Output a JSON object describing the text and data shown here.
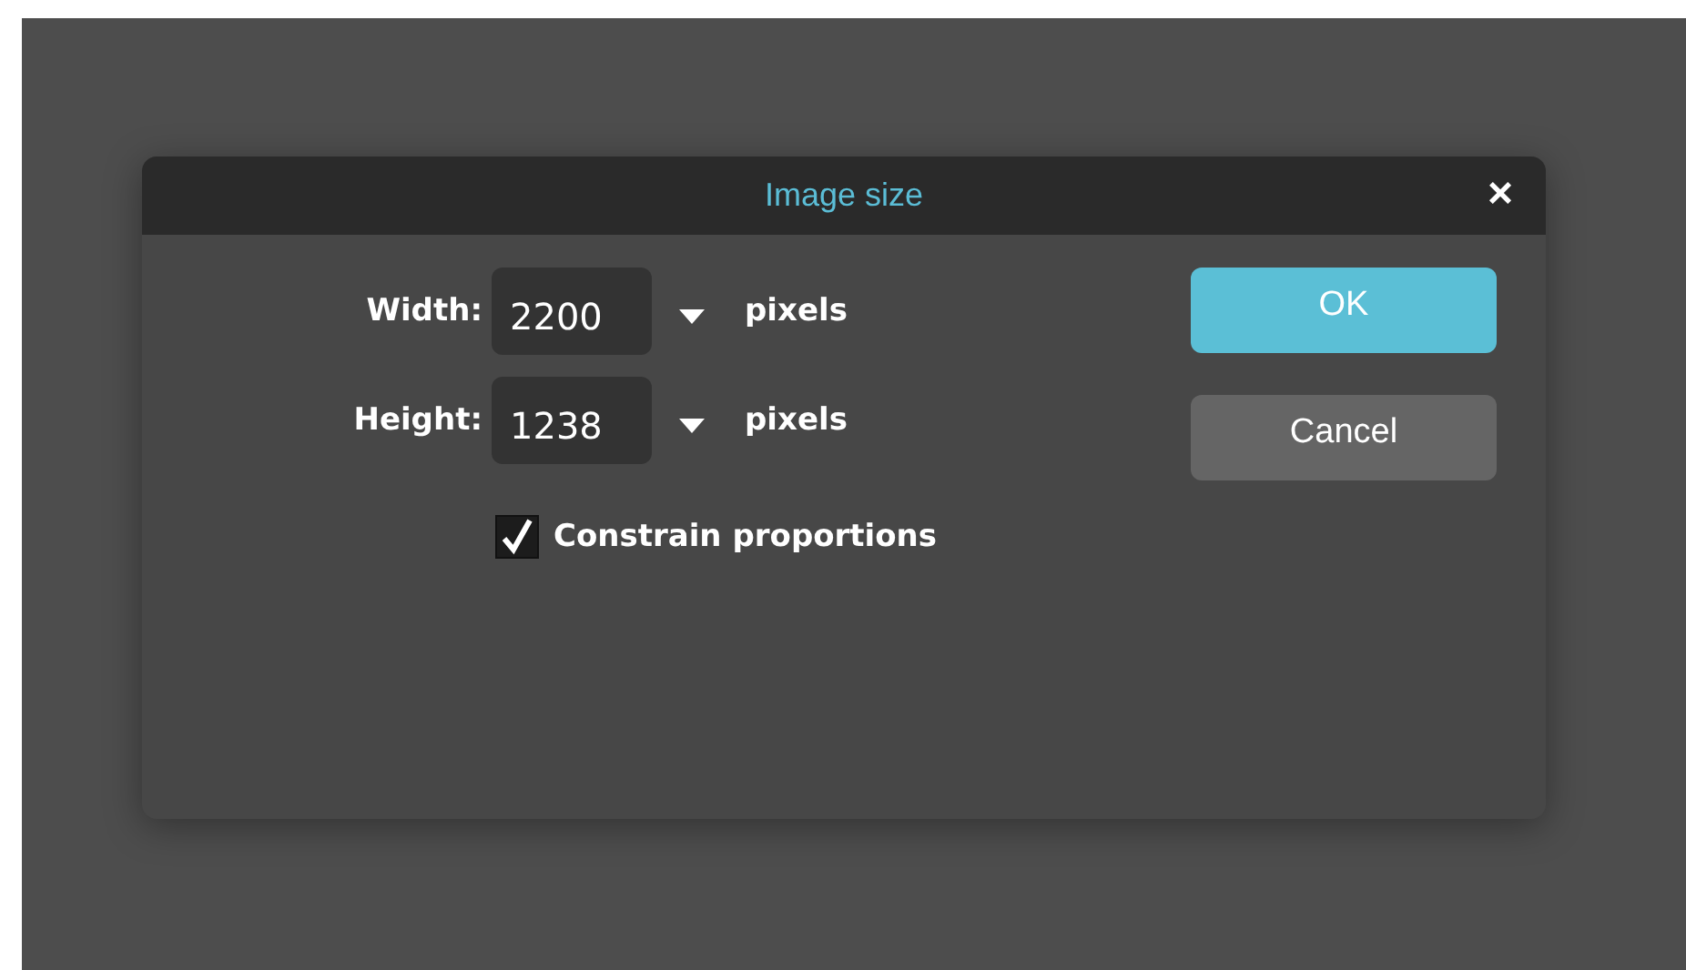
{
  "dialog": {
    "title": "Image size",
    "close": "×"
  },
  "fields": [
    {
      "label": "Width:",
      "value": "2200",
      "unit": "pixels"
    },
    {
      "label": "Height:",
      "value": "1238",
      "unit": "pixels"
    }
  ],
  "checkbox": {
    "label": "Constrain proportions",
    "checked": true
  },
  "buttons": [
    {
      "label": "OK",
      "kind": "primary"
    },
    {
      "label": "Cancel",
      "kind": "secondary"
    }
  ]
}
